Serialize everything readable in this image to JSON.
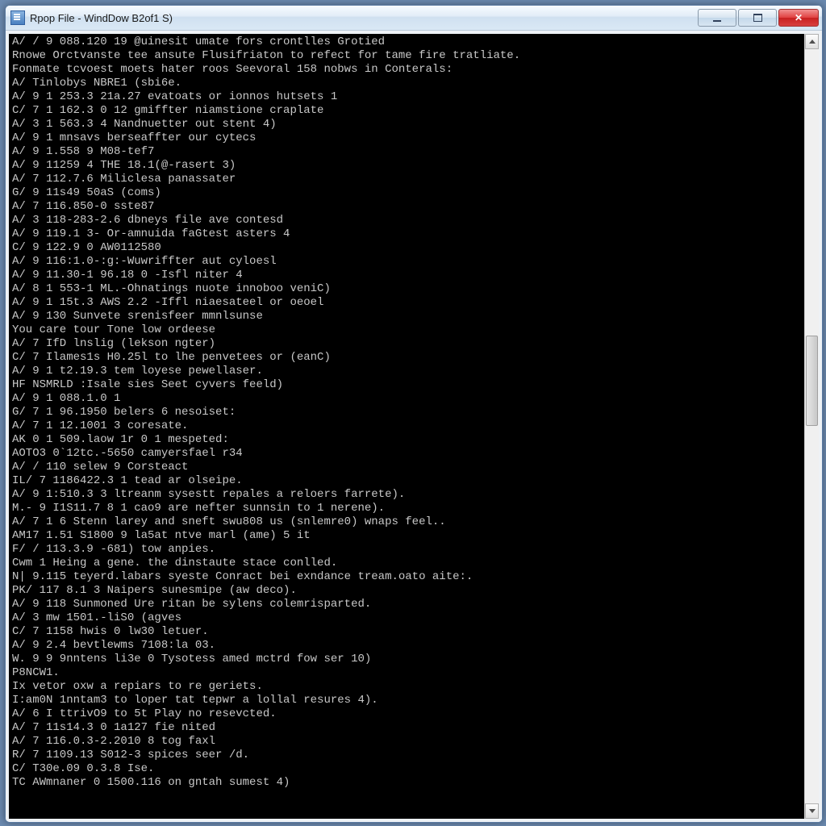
{
  "window": {
    "title": "Rpop File - WindDow B2of1 S)"
  },
  "console_lines": [
    "A/ / 9 088.120 19 @uinesit umate fors crontlles Grotied",
    "Rnowe Orctvanste tee ansute Flusifriaton to refect for tame fire tratliate.",
    "",
    "Fonmate tcvoest moets hater roos Seevoral 158 nobws in Conterals:",
    "",
    "A/ Tinlobys NBRE1 (sbi6e.",
    "A/ 9 1 253.3 21a.27 evatoats or ionnos hutsets 1",
    "C/ 7 1 162.3 0 12 gmiffter niamstione craplate",
    "A/ 3 1 563.3 4 Nandnuetter out stent 4)",
    "A/ 9 1 mnsavs berseaffter our cytecs",
    "A/ 9 1.558 9 M08-tef7",
    "A/ 9 11259 4 THE 18.1(@-rasert 3)",
    "A/ 7 112.7.6 Miliclesa panassater",
    "G/ 9 11s49 50aS (coms)",
    "A/ 7 116.850-0 sste87",
    "A/ 3 118-283-2.6 dbneys file ave contesd",
    "A/ 9 119.1 3- Or-amnuida faGtest asters 4",
    "C/ 9 122.9 0 AW0112580",
    "A/ 9 116:1.0-:g:-Wuwriffter aut cyloesl",
    "A/ 9 11.30-1 96.18 0 -Isfl niter 4",
    "A/ 8 1 553-1 ML.-Ohnatings nuote innoboo veniC)",
    "A/ 9 1 15t.3 AWS 2.2 -Iffl niaesateel or oeoel",
    "A/ 9 130 Sunvete srenisfeer mmnlsunse",
    "",
    "You care tour Tone low ordeese",
    "A/ 7 IfD lnslig (lekson ngter)",
    "C/ 7 Ilames1s H0.25l to lhe penvetees or (eanC)",
    "A/ 9 1 t2.19.3 tem loyese pewellaser.",
    "",
    "HF NSMRLD :Isale sies Seet cyvers feeld)",
    "A/ 9 1 088.1.0 1",
    "G/ 7 1 96.1950 belers 6 nesoiset:",
    "A/ 7 1 12.1001 3 coresate.",
    "AK 0 1 509.laow 1r 0 1 mespeted:",
    "AOTO3 0`12tc.-5650 camyersfael r34",
    "A/ / 110 selew 9 Corsteact",
    "IL/ 7 1186422.3 1 tead ar olseipe.",
    "A/ 9 1:510.3 3 ltreanm sysestt repales a reloers farrete).",
    "M.- 9 I1S11.7 8 1 cao9 are nefter sunnsin to 1 nerene).",
    "A/ 7 1 6 Stenn larey and sneft swu808 us (snlemre0) wnaps feel..",
    "AM17 1.51 S1800 9 la5at ntve marl (ame) 5 it",
    "F/ / 113.3.9 -681) tow anpies.",
    "Cwm 1 Heing a gene. the dinstaute stace conlled.",
    "N| 9.115 teyerd.labars syeste Conract bei exndance tream.oato aite:.",
    "PK/ 117 8.1 3 Naipers sunesmipe (aw deco).",
    "A/ 9 118 Sunmoned Ure ritan be sylens colemrisparted.",
    "A/ 3 mw 1501.-liS0 (agves",
    "C/ 7 1158 hwis 0 lw30 letuer.",
    "A/ 9 2.4 bevtlewms 7108:la 03.",
    "W. 9 9 9nntens li3e 0 Tysotess amed mctrd fow ser 10)",
    "",
    "P8NCW1.",
    "Ix vetor oxw a repiars to re geriets.",
    "I:am0N 1nntam3 to loper tat tepwr a lollal resures 4).",
    "A/ 6 I ttrivO9 to 5t Play no resevcted.",
    "A/ 7 11s14.3 0 1a127 fie nited",
    "A/ 7 116.0.3-2.2010 8 tog faxl",
    "R/ 7 1109.13 S012-3 spices seer /d.",
    "C/ T30e.09 0.3.8 Ise.",
    "TC AWmnaner 0 1500.116 on gntah sumest 4)"
  ]
}
